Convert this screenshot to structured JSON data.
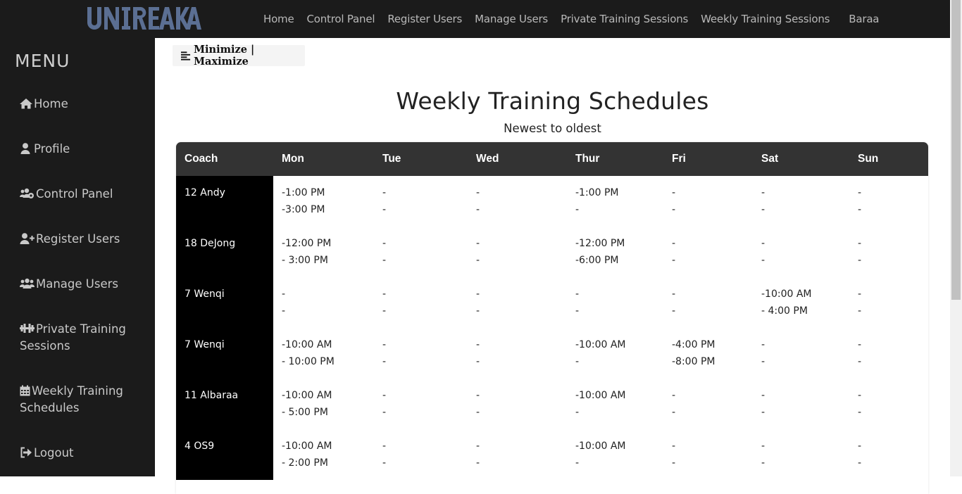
{
  "brand": {
    "logo_text": "UNBREAKABLE"
  },
  "topnav": {
    "items": [
      "Home",
      "Control Panel",
      "Register Users",
      "Manage Users",
      "Private Training Sessions",
      "Weekly Training Sessions"
    ],
    "user": "Baraa"
  },
  "sidebar": {
    "title": "MENU",
    "items": [
      {
        "label": "Home",
        "icon": "home-icon"
      },
      {
        "label": "Profile",
        "icon": "user-icon"
      },
      {
        "label": "Control Panel",
        "icon": "users-cog-icon"
      },
      {
        "label": "Register Users",
        "icon": "user-plus-icon"
      },
      {
        "label": "Manage Users",
        "icon": "users-icon"
      },
      {
        "label": "Private Training Sessions",
        "icon": "dumbbell-icon"
      },
      {
        "label": "Weekly Training Schedules",
        "icon": "calendar-icon"
      },
      {
        "label": "Logout",
        "icon": "sign-out-icon"
      }
    ]
  },
  "main": {
    "toggle_label": "Minimize | Maximize",
    "title": "Weekly Training Schedules",
    "subtitle": "Newest to oldest"
  },
  "table": {
    "headers": [
      "Coach",
      "Mon",
      "Tue",
      "Wed",
      "Thur",
      "Fri",
      "Sat",
      "Sun"
    ],
    "rows": [
      {
        "coach": "12 Andy",
        "days": [
          [
            "-1:00 PM",
            "-3:00 PM"
          ],
          [
            "-",
            "-"
          ],
          [
            "-",
            "-"
          ],
          [
            "-1:00 PM",
            "-"
          ],
          [
            "-",
            "-"
          ],
          [
            "-",
            "-"
          ],
          [
            "-",
            "-"
          ]
        ]
      },
      {
        "coach": "18 DeJong",
        "days": [
          [
            "-12:00 PM",
            "- 3:00 PM"
          ],
          [
            "-",
            "-"
          ],
          [
            "-",
            "-"
          ],
          [
            "-12:00 PM",
            "-6:00 PM"
          ],
          [
            "-",
            "-"
          ],
          [
            "-",
            "-"
          ],
          [
            "-",
            "-"
          ]
        ]
      },
      {
        "coach": "7 Wenqi",
        "days": [
          [
            "-",
            "-"
          ],
          [
            "-",
            "-"
          ],
          [
            "-",
            "-"
          ],
          [
            "-",
            "-"
          ],
          [
            "-",
            "-"
          ],
          [
            "-10:00 AM",
            "- 4:00 PM"
          ],
          [
            "-",
            "-"
          ]
        ]
      },
      {
        "coach": "7 Wenqi",
        "days": [
          [
            "-10:00 AM",
            "- 10:00 PM"
          ],
          [
            "-",
            "-"
          ],
          [
            "-",
            "-"
          ],
          [
            "-10:00 AM",
            "-"
          ],
          [
            "-4:00 PM",
            "-8:00 PM"
          ],
          [
            "-",
            "-"
          ],
          [
            "-",
            "-"
          ]
        ]
      },
      {
        "coach": "11 Albaraa",
        "days": [
          [
            "-10:00 AM",
            "- 5:00 PM"
          ],
          [
            "-",
            "-"
          ],
          [
            "-",
            "-"
          ],
          [
            "-10:00 AM",
            "-"
          ],
          [
            "-",
            "-"
          ],
          [
            "-",
            "-"
          ],
          [
            "-",
            "-"
          ]
        ]
      },
      {
        "coach": "4 OS9",
        "days": [
          [
            "-10:00 AM",
            "- 2:00 PM"
          ],
          [
            "-",
            "-"
          ],
          [
            "-",
            "-"
          ],
          [
            "-10:00 AM",
            "-"
          ],
          [
            "-",
            "-"
          ],
          [
            "-",
            "-"
          ],
          [
            "-",
            "-"
          ]
        ]
      }
    ]
  },
  "colors": {
    "bar": "#1b1b1b",
    "header": "#333333",
    "coach_cell": "#000000",
    "logo": "#5b6f93"
  }
}
